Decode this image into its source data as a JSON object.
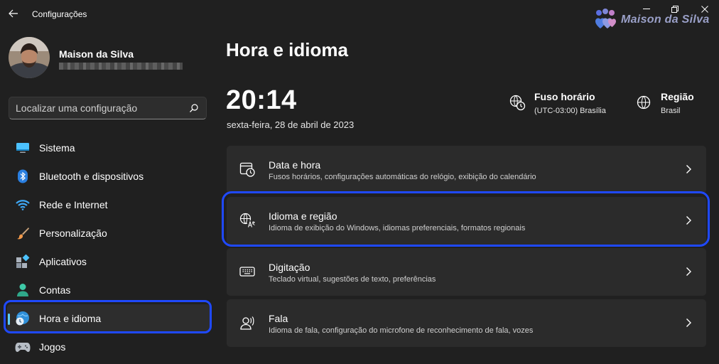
{
  "window": {
    "title": "Configurações",
    "watermark": "Maison da Silva"
  },
  "profile": {
    "name": "Maison da Silva"
  },
  "search": {
    "placeholder": "Localizar uma configuração"
  },
  "nav": [
    {
      "label": "Sistema",
      "icon": "monitor-icon"
    },
    {
      "label": "Bluetooth e dispositivos",
      "icon": "bluetooth-icon"
    },
    {
      "label": "Rede e Internet",
      "icon": "wifi-icon"
    },
    {
      "label": "Personalização",
      "icon": "brush-icon"
    },
    {
      "label": "Aplicativos",
      "icon": "apps-icon"
    },
    {
      "label": "Contas",
      "icon": "person-icon"
    },
    {
      "label": "Hora e idioma",
      "icon": "globe-clock-icon",
      "active": true
    },
    {
      "label": "Jogos",
      "icon": "gamepad-icon"
    }
  ],
  "main": {
    "title": "Hora e idioma",
    "time": "20:14",
    "date": "sexta-feira, 28 de abril de 2023",
    "timezone": {
      "title": "Fuso horário",
      "value": "(UTC-03:00) Brasília"
    },
    "region": {
      "title": "Região",
      "value": "Brasil"
    },
    "cards": [
      {
        "title": "Data e hora",
        "subtitle": "Fusos horários, configurações automáticas do relógio, exibição do calendário",
        "icon": "calendar-clock-icon"
      },
      {
        "title": "Idioma e região",
        "subtitle": "Idioma de exibição do Windows, idiomas preferenciais, formatos regionais",
        "icon": "language-icon"
      },
      {
        "title": "Digitação",
        "subtitle": "Teclado virtual, sugestões de texto, preferências",
        "icon": "keyboard-icon"
      },
      {
        "title": "Fala",
        "subtitle": "Idioma de fala, configuração do microfone de reconhecimento de fala, vozes",
        "icon": "speech-icon"
      }
    ]
  },
  "colors": {
    "background": "#202020",
    "card": "#2b2b2b",
    "accent": "#60cdff",
    "highlight": "#1f49ff"
  }
}
